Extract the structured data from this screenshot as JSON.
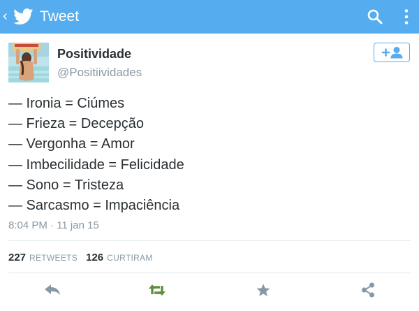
{
  "topbar": {
    "title": "Tweet",
    "back_glyph": "‹",
    "icons": [
      "chevron-left-icon",
      "twitter-bird-icon",
      "search-icon",
      "overflow-menu-icon"
    ],
    "color": "#55acee"
  },
  "tweet": {
    "author_name": "Positividade",
    "author_handle": "@Positiividades",
    "lines": [
      "— Ironia = Ciúmes",
      "— Frieza = Decepção",
      "— Vergonha = Amor",
      "— Imbecilidade = Felicidade",
      "— Sono = Tristeza",
      "— Sarcasmo = Impaciência"
    ],
    "timestamp": "8:04 PM · 11 jan 15",
    "follow_icon": "add-user-icon"
  },
  "stats": {
    "retweets_count": "227",
    "retweets_label": "RETWEETS",
    "likes_count": "126",
    "likes_label": "CURTIRAM"
  },
  "actions": {
    "icons": [
      "reply-icon",
      "retweet-icon",
      "favorite-icon",
      "share-icon"
    ],
    "retweet_color": "#5c913b",
    "default_color": "#8899a6"
  }
}
